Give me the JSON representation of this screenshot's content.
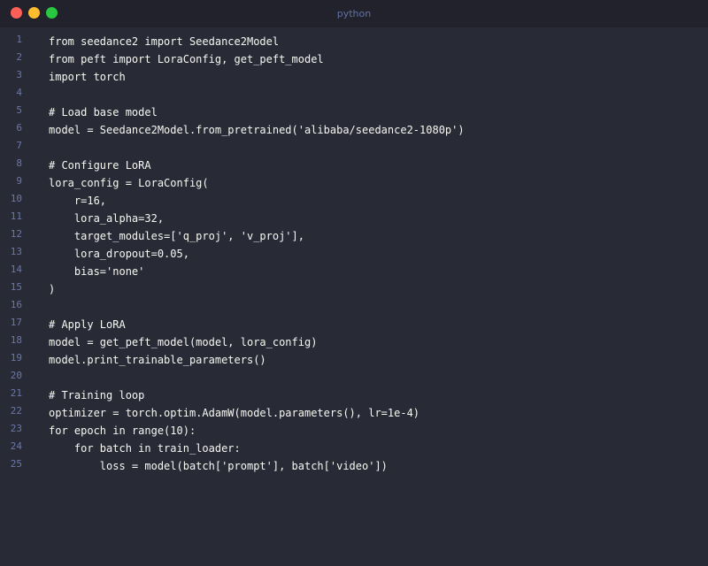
{
  "window": {
    "title": "python"
  },
  "editor": {
    "lines": [
      {
        "n": "1",
        "text": "from seedance2 import Seedance2Model"
      },
      {
        "n": "2",
        "text": "from peft import LoraConfig, get_peft_model"
      },
      {
        "n": "3",
        "text": "import torch"
      },
      {
        "n": "4",
        "text": ""
      },
      {
        "n": "5",
        "text": "# Load base model"
      },
      {
        "n": "6",
        "text": "model = Seedance2Model.from_pretrained('alibaba/seedance2-1080p')"
      },
      {
        "n": "7",
        "text": ""
      },
      {
        "n": "8",
        "text": "# Configure LoRA"
      },
      {
        "n": "9",
        "text": "lora_config = LoraConfig("
      },
      {
        "n": "10",
        "text": "    r=16,"
      },
      {
        "n": "11",
        "text": "    lora_alpha=32,"
      },
      {
        "n": "12",
        "text": "    target_modules=['q_proj', 'v_proj'],"
      },
      {
        "n": "13",
        "text": "    lora_dropout=0.05,"
      },
      {
        "n": "14",
        "text": "    bias='none'"
      },
      {
        "n": "15",
        "text": ")"
      },
      {
        "n": "16",
        "text": ""
      },
      {
        "n": "17",
        "text": "# Apply LoRA"
      },
      {
        "n": "18",
        "text": "model = get_peft_model(model, lora_config)"
      },
      {
        "n": "19",
        "text": "model.print_trainable_parameters()"
      },
      {
        "n": "20",
        "text": ""
      },
      {
        "n": "21",
        "text": "# Training loop"
      },
      {
        "n": "22",
        "text": "optimizer = torch.optim.AdamW(model.parameters(), lr=1e-4)"
      },
      {
        "n": "23",
        "text": "for epoch in range(10):"
      },
      {
        "n": "24",
        "text": "    for batch in train_loader:"
      },
      {
        "n": "25",
        "text": "        loss = model(batch['prompt'], batch['video'])"
      }
    ]
  }
}
